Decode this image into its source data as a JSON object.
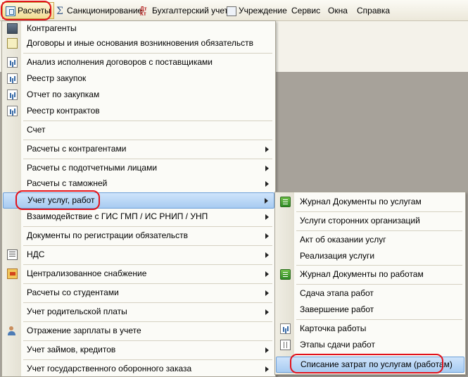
{
  "menubar": {
    "items": [
      "Расчеты",
      "Санкционирование",
      "Бухгалтерский учет",
      "Учреждение",
      "Сервис",
      "Окна",
      "Справка"
    ],
    "icons": [
      "document-icon",
      "sigma-icon",
      "dt-kt-icon",
      "institution-icon"
    ]
  },
  "main_menu": {
    "items": [
      {
        "label": "Контрагенты",
        "icon": "folder-icon"
      },
      {
        "label": "Договоры и иные основания возникновения обязательств",
        "icon": "contract-icon"
      },
      {
        "label": "Анализ исполнения договоров с поставщиками",
        "icon": "report-icon"
      },
      {
        "label": "Реестр закупок",
        "icon": "report-icon"
      },
      {
        "label": "Отчет по закупкам",
        "icon": "report-icon"
      },
      {
        "label": "Реестр контрактов",
        "icon": "report-icon"
      },
      {
        "label": "Счет"
      },
      {
        "label": "Расчеты с контрагентами",
        "submenu": true
      },
      {
        "label": "Расчеты с подотчетными лицами",
        "submenu": true
      },
      {
        "label": "Расчеты с таможней",
        "submenu": true
      },
      {
        "label": "Учет услуг, работ",
        "submenu": true,
        "selected": true
      },
      {
        "label": "Взаимодействие с ГИС ГМП / ИС РНИП / УНП",
        "submenu": true
      },
      {
        "label": "Документы по регистрации обязательств",
        "submenu": true
      },
      {
        "label": "НДС",
        "submenu": true,
        "icon": "vat-icon"
      },
      {
        "label": "Централизованное снабжение",
        "submenu": true,
        "icon": "supply-icon"
      },
      {
        "label": "Расчеты со студентами",
        "submenu": true
      },
      {
        "label": "Учет родительской платы",
        "submenu": true
      },
      {
        "label": "Отражение зарплаты в учете",
        "icon": "people-icon"
      },
      {
        "label": "Учет займов, кредитов",
        "submenu": true
      },
      {
        "label": "Учет государственного оборонного заказа",
        "submenu": true
      }
    ]
  },
  "submenu": {
    "items": [
      {
        "label": "Журнал Документы по услугам",
        "icon": "journal-icon"
      },
      {
        "label": "Услуги сторонних организаций"
      },
      {
        "label": "Акт об оказании услуг"
      },
      {
        "label": "Реализация услуги"
      },
      {
        "label": "Журнал Документы по работам",
        "icon": "journal-icon"
      },
      {
        "label": "Сдача этапа работ"
      },
      {
        "label": "Завершение работ"
      },
      {
        "label": "Карточка работы",
        "icon": "report-icon"
      },
      {
        "label": "Этапы сдачи работ",
        "icon": "grid-icon"
      },
      {
        "label": "Списание затрат по услугам (работам)",
        "selected": true
      }
    ]
  },
  "colors": {
    "highlight_ring": "#e2121b",
    "selection": "#a7cbf1",
    "workspace": "#a7a29a"
  }
}
